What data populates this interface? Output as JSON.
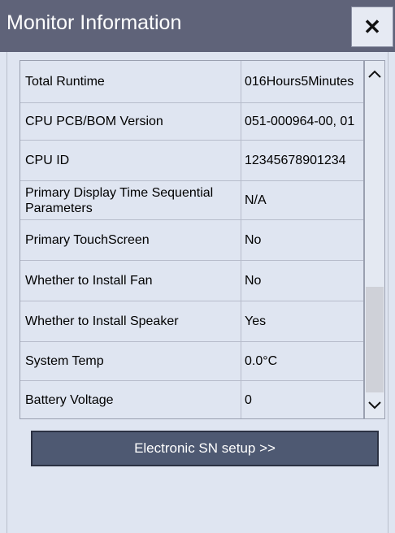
{
  "window": {
    "title": "Monitor Information",
    "close_label": "✕"
  },
  "table": {
    "rows": [
      {
        "label": "Total Runtime",
        "value": "016Hours5Minutes"
      },
      {
        "label": "CPU PCB/BOM Version",
        "value": "051-000964-00, 01"
      },
      {
        "label": "CPU ID",
        "value": "12345678901234"
      },
      {
        "label": "Primary Display Time Sequential Parameters",
        "value": "N/A"
      },
      {
        "label": "Primary TouchScreen",
        "value": "No"
      },
      {
        "label": "Whether to Install Fan",
        "value": "No"
      },
      {
        "label": "Whether to Install Speaker",
        "value": "Yes"
      },
      {
        "label": "System Temp",
        "value": "0.0°C"
      },
      {
        "label": "Battery Voltage",
        "value": "0"
      }
    ]
  },
  "scrollbar": {
    "up_icon": "chevron-up-icon",
    "down_icon": "chevron-down-icon"
  },
  "actions": {
    "sn_setup_label": "Electronic SN setup >>"
  },
  "colors": {
    "titlebar": "#5f6379",
    "background": "#dfe5f1",
    "button": "#4e5972"
  }
}
